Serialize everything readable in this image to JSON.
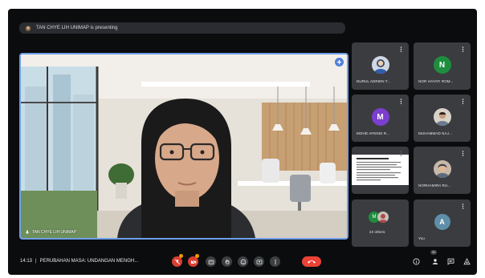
{
  "presenting_banner": "TAN CHYE LIH UNIMAP is presenting",
  "main_speaker_name": "TAN CHYE LIH UNIMAP",
  "participants": [
    {
      "name": "NURUL ADRIEN T...",
      "avatar_type": "photo"
    },
    {
      "name": "NOR HAYATI ROM...",
      "avatar_type": "letter",
      "letter": "N",
      "color": "#1e8e3e"
    },
    {
      "name": "MOHD AFENDI R...",
      "avatar_type": "letter",
      "letter": "M",
      "color": "#7b3fd0"
    },
    {
      "name": "MUHAMMAD NAJ...",
      "avatar_type": "photo"
    },
    {
      "name": "presentation",
      "avatar_type": "screen"
    },
    {
      "name": "NORHAMIRA RU...",
      "avatar_type": "photo"
    },
    {
      "name": "22 others",
      "avatar_type": "group"
    },
    {
      "name": "You",
      "avatar_type": "letter",
      "letter": "A",
      "color": "#5f8fa8"
    }
  ],
  "meeting": {
    "time": "14:13",
    "separator": "|",
    "title": "PERUBAHAN MASA: UNDANGAN MENGH..."
  },
  "people_badge": "30",
  "colors": {
    "background": "#0b0c0e",
    "tile": "#3b3c40",
    "active_border": "#6fa0ea",
    "hangup": "#ea4335"
  },
  "icons": [
    "presenter-icon",
    "pin-icon",
    "mic-off-icon",
    "camera-off-icon",
    "captions-icon",
    "raise-hand-icon",
    "emoji-icon",
    "present-screen-icon",
    "more-options-icon",
    "hang-up-icon",
    "info-icon",
    "people-icon",
    "chat-icon",
    "activities-icon"
  ]
}
